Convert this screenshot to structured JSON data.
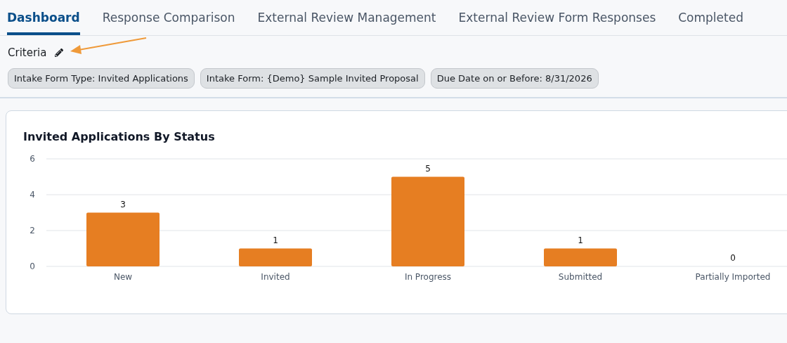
{
  "tabs": [
    {
      "label": "Dashboard",
      "selected": true
    },
    {
      "label": "Response Comparison",
      "selected": false
    },
    {
      "label": "External Review Management",
      "selected": false
    },
    {
      "label": "External Review Form Responses",
      "selected": false
    },
    {
      "label": "Completed",
      "selected": false
    }
  ],
  "criteria": {
    "label": "Criteria",
    "chips": [
      "Intake Form Type: Invited Applications",
      "Intake Form: {Demo} Sample Invited Proposal",
      "Due Date on or Before: 8/31/2026"
    ]
  },
  "chart_card": {
    "title": "Invited Applications By Status",
    "chart_data": {
      "type": "bar",
      "categories": [
        "New",
        "Invited",
        "In Progress",
        "Submitted",
        "Partially Imported"
      ],
      "series": [
        {
          "color": "#e67e22",
          "values": [
            3,
            1,
            5,
            1,
            0
          ]
        }
      ],
      "ylim": [
        0,
        6
      ],
      "yticks": [
        0,
        2,
        4,
        6
      ],
      "data_labels": true
    }
  }
}
